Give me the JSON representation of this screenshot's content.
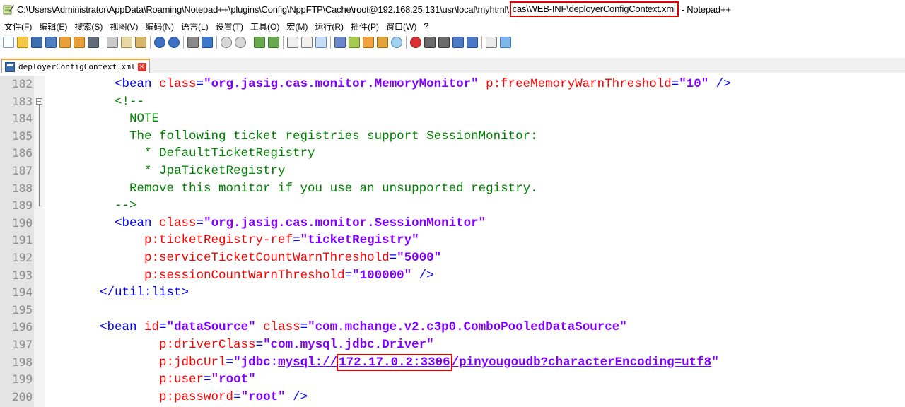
{
  "window": {
    "title_prefix": "C:\\Users\\Administrator\\AppData\\Roaming\\Notepad++\\plugins\\Config\\NppFTP\\Cache\\root@192.168.25.131\\usr\\local\\myhtml\\",
    "title_highlight": "cas\\WEB-INF\\deployerConfigContext.xml",
    "title_suffix": "- Notepad++"
  },
  "menu": [
    "文件(F)",
    "编辑(E)",
    "搜索(S)",
    "视图(V)",
    "编码(N)",
    "语言(L)",
    "设置(T)",
    "工具(O)",
    "宏(M)",
    "运行(R)",
    "插件(P)",
    "窗口(W)",
    "?"
  ],
  "tab": {
    "label": "deployerConfigContext.xml"
  },
  "colors": {
    "tag": "#0000ff",
    "attr": "#ff0000",
    "value": "#8000ff",
    "comment": "#008000",
    "highlight": "#e00000"
  },
  "lines": [
    {
      "num": "182",
      "segments": [
        {
          "t": "        "
        },
        {
          "c": "tag",
          "t": "<bean "
        },
        {
          "c": "attr",
          "t": "class"
        },
        {
          "c": "tag",
          "t": "="
        },
        {
          "c": "val",
          "t": "\"org.jasig.cas.monitor.MemoryMonitor\""
        },
        {
          "t": " "
        },
        {
          "c": "attr",
          "t": "p:freeMemoryWarnThreshold"
        },
        {
          "c": "tag",
          "t": "="
        },
        {
          "c": "val",
          "t": "\"10\""
        },
        {
          "c": "tag",
          "t": " />"
        }
      ]
    },
    {
      "num": "183",
      "segments": [
        {
          "t": "        "
        },
        {
          "c": "cm",
          "t": "<!--"
        }
      ]
    },
    {
      "num": "184",
      "segments": [
        {
          "c": "cm",
          "t": "          NOTE"
        }
      ]
    },
    {
      "num": "185",
      "segments": [
        {
          "c": "cm",
          "t": "          The following ticket registries support SessionMonitor:"
        }
      ]
    },
    {
      "num": "186",
      "segments": [
        {
          "c": "cm",
          "t": "            * DefaultTicketRegistry"
        }
      ]
    },
    {
      "num": "187",
      "segments": [
        {
          "c": "cm",
          "t": "            * JpaTicketRegistry"
        }
      ]
    },
    {
      "num": "188",
      "segments": [
        {
          "c": "cm",
          "t": "          Remove this monitor if you use an unsupported registry."
        }
      ]
    },
    {
      "num": "189",
      "segments": [
        {
          "c": "cm",
          "t": "        -->"
        }
      ]
    },
    {
      "num": "190",
      "segments": [
        {
          "t": "        "
        },
        {
          "c": "tag",
          "t": "<bean "
        },
        {
          "c": "attr",
          "t": "class"
        },
        {
          "c": "tag",
          "t": "="
        },
        {
          "c": "val",
          "t": "\"org.jasig.cas.monitor.SessionMonitor\""
        }
      ]
    },
    {
      "num": "191",
      "segments": [
        {
          "t": "            "
        },
        {
          "c": "attr",
          "t": "p:ticketRegistry-ref"
        },
        {
          "c": "tag",
          "t": "="
        },
        {
          "c": "val",
          "t": "\"ticketRegistry\""
        }
      ]
    },
    {
      "num": "192",
      "segments": [
        {
          "t": "            "
        },
        {
          "c": "attr",
          "t": "p:serviceTicketCountWarnThreshold"
        },
        {
          "c": "tag",
          "t": "="
        },
        {
          "c": "val",
          "t": "\"5000\""
        }
      ]
    },
    {
      "num": "193",
      "segments": [
        {
          "t": "            "
        },
        {
          "c": "attr",
          "t": "p:sessionCountWarnThreshold"
        },
        {
          "c": "tag",
          "t": "="
        },
        {
          "c": "val",
          "t": "\"100000\""
        },
        {
          "c": "tag",
          "t": " />"
        }
      ]
    },
    {
      "num": "194",
      "segments": [
        {
          "t": "      "
        },
        {
          "c": "tag",
          "t": "</util:list>"
        }
      ]
    },
    {
      "num": "195",
      "segments": []
    },
    {
      "num": "196",
      "segments": [
        {
          "t": "      "
        },
        {
          "c": "tag",
          "t": "<bean "
        },
        {
          "c": "attr",
          "t": "id"
        },
        {
          "c": "tag",
          "t": "="
        },
        {
          "c": "val",
          "t": "\"dataSource\""
        },
        {
          "t": " "
        },
        {
          "c": "attr",
          "t": "class"
        },
        {
          "c": "tag",
          "t": "="
        },
        {
          "c": "val",
          "t": "\"com.mchange.v2.c3p0.ComboPooledDataSource\""
        }
      ]
    },
    {
      "num": "197",
      "segments": [
        {
          "t": "              "
        },
        {
          "c": "attr",
          "t": "p:driverClass"
        },
        {
          "c": "tag",
          "t": "="
        },
        {
          "c": "val",
          "t": "\"com.mysql.jdbc.Driver\""
        }
      ]
    },
    {
      "num": "198",
      "segments": [
        {
          "t": "              "
        },
        {
          "c": "attr",
          "t": "p:jdbcUrl"
        },
        {
          "c": "tag",
          "t": "="
        },
        {
          "c": "val",
          "t": "\"jdbc:"
        },
        {
          "c": "val ul",
          "t": "mysql://"
        },
        {
          "c": "val ul hlbox",
          "t": "172.17.0.2:3306"
        },
        {
          "c": "val ul",
          "t": "/pinyougoudb?characterEncoding=utf8"
        },
        {
          "c": "val",
          "t": "\""
        }
      ]
    },
    {
      "num": "199",
      "segments": [
        {
          "t": "              "
        },
        {
          "c": "attr",
          "t": "p:user"
        },
        {
          "c": "tag",
          "t": "="
        },
        {
          "c": "val",
          "t": "\"root\""
        }
      ]
    },
    {
      "num": "200",
      "segments": [
        {
          "t": "              "
        },
        {
          "c": "attr",
          "t": "p:password"
        },
        {
          "c": "tag",
          "t": "="
        },
        {
          "c": "val",
          "t": "\"root\""
        },
        {
          "c": "tag",
          "t": " />"
        }
      ]
    }
  ]
}
